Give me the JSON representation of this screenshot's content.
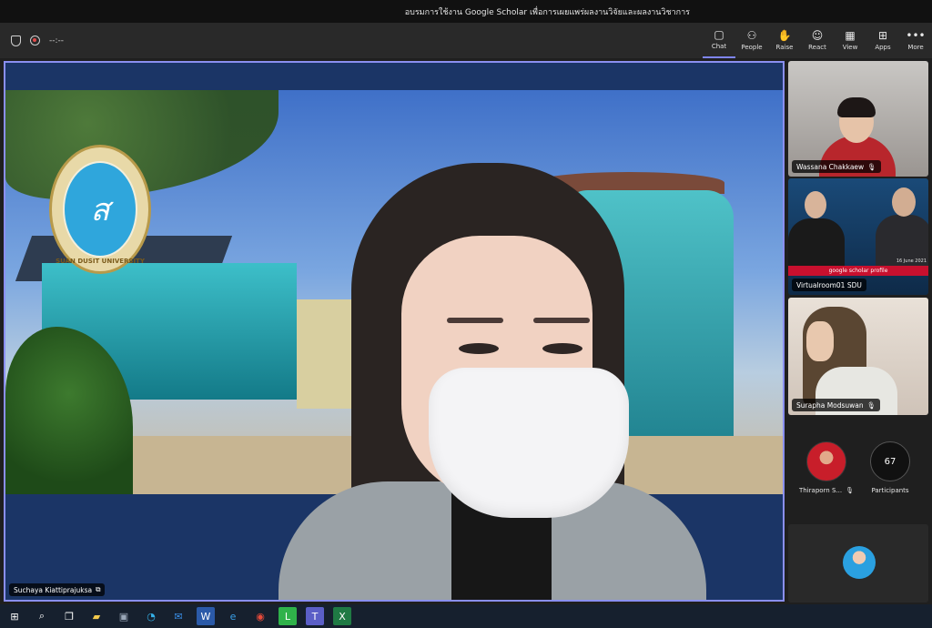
{
  "window": {
    "title": "อบรมการใช้งาน Google Scholar เพื่อการเผยแพร่ผลงานวิจัยและผลงานวิชาการ"
  },
  "toolbar": {
    "timer": "--:--",
    "buttons": [
      {
        "label": "Chat",
        "icon": "chat-icon"
      },
      {
        "label": "People",
        "icon": "people-icon"
      },
      {
        "label": "Raise",
        "icon": "hand-icon"
      },
      {
        "label": "React",
        "icon": "smiley-icon"
      },
      {
        "label": "View",
        "icon": "grid-icon"
      },
      {
        "label": "Apps",
        "icon": "apps-plus-icon"
      },
      {
        "label": "More",
        "icon": "more-dots-icon"
      }
    ]
  },
  "main": {
    "presenter_name": "Suchaya Kiattiprajuksa",
    "logo_text": "SUAN DUSIT UNIVERSITY"
  },
  "participants": {
    "tiles": [
      {
        "name": "Wassana Chakkaew"
      },
      {
        "name": "Virtualroom01 SDU",
        "screen_text": "google scholar profile",
        "date_text": "16 June 2021"
      },
      {
        "name": "Surapha Modsuwan"
      }
    ],
    "small_name": "Thiraporn S...",
    "count": "67",
    "count_label": "Participants"
  },
  "taskbar": {
    "icons": [
      "windows-start-icon",
      "search-icon",
      "task-view-icon",
      "file-explorer-icon",
      "store-icon",
      "edge-icon",
      "mail-icon",
      "word-icon",
      "ie-icon",
      "chrome-icon",
      "line-icon",
      "teams-icon",
      "excel-icon"
    ]
  }
}
